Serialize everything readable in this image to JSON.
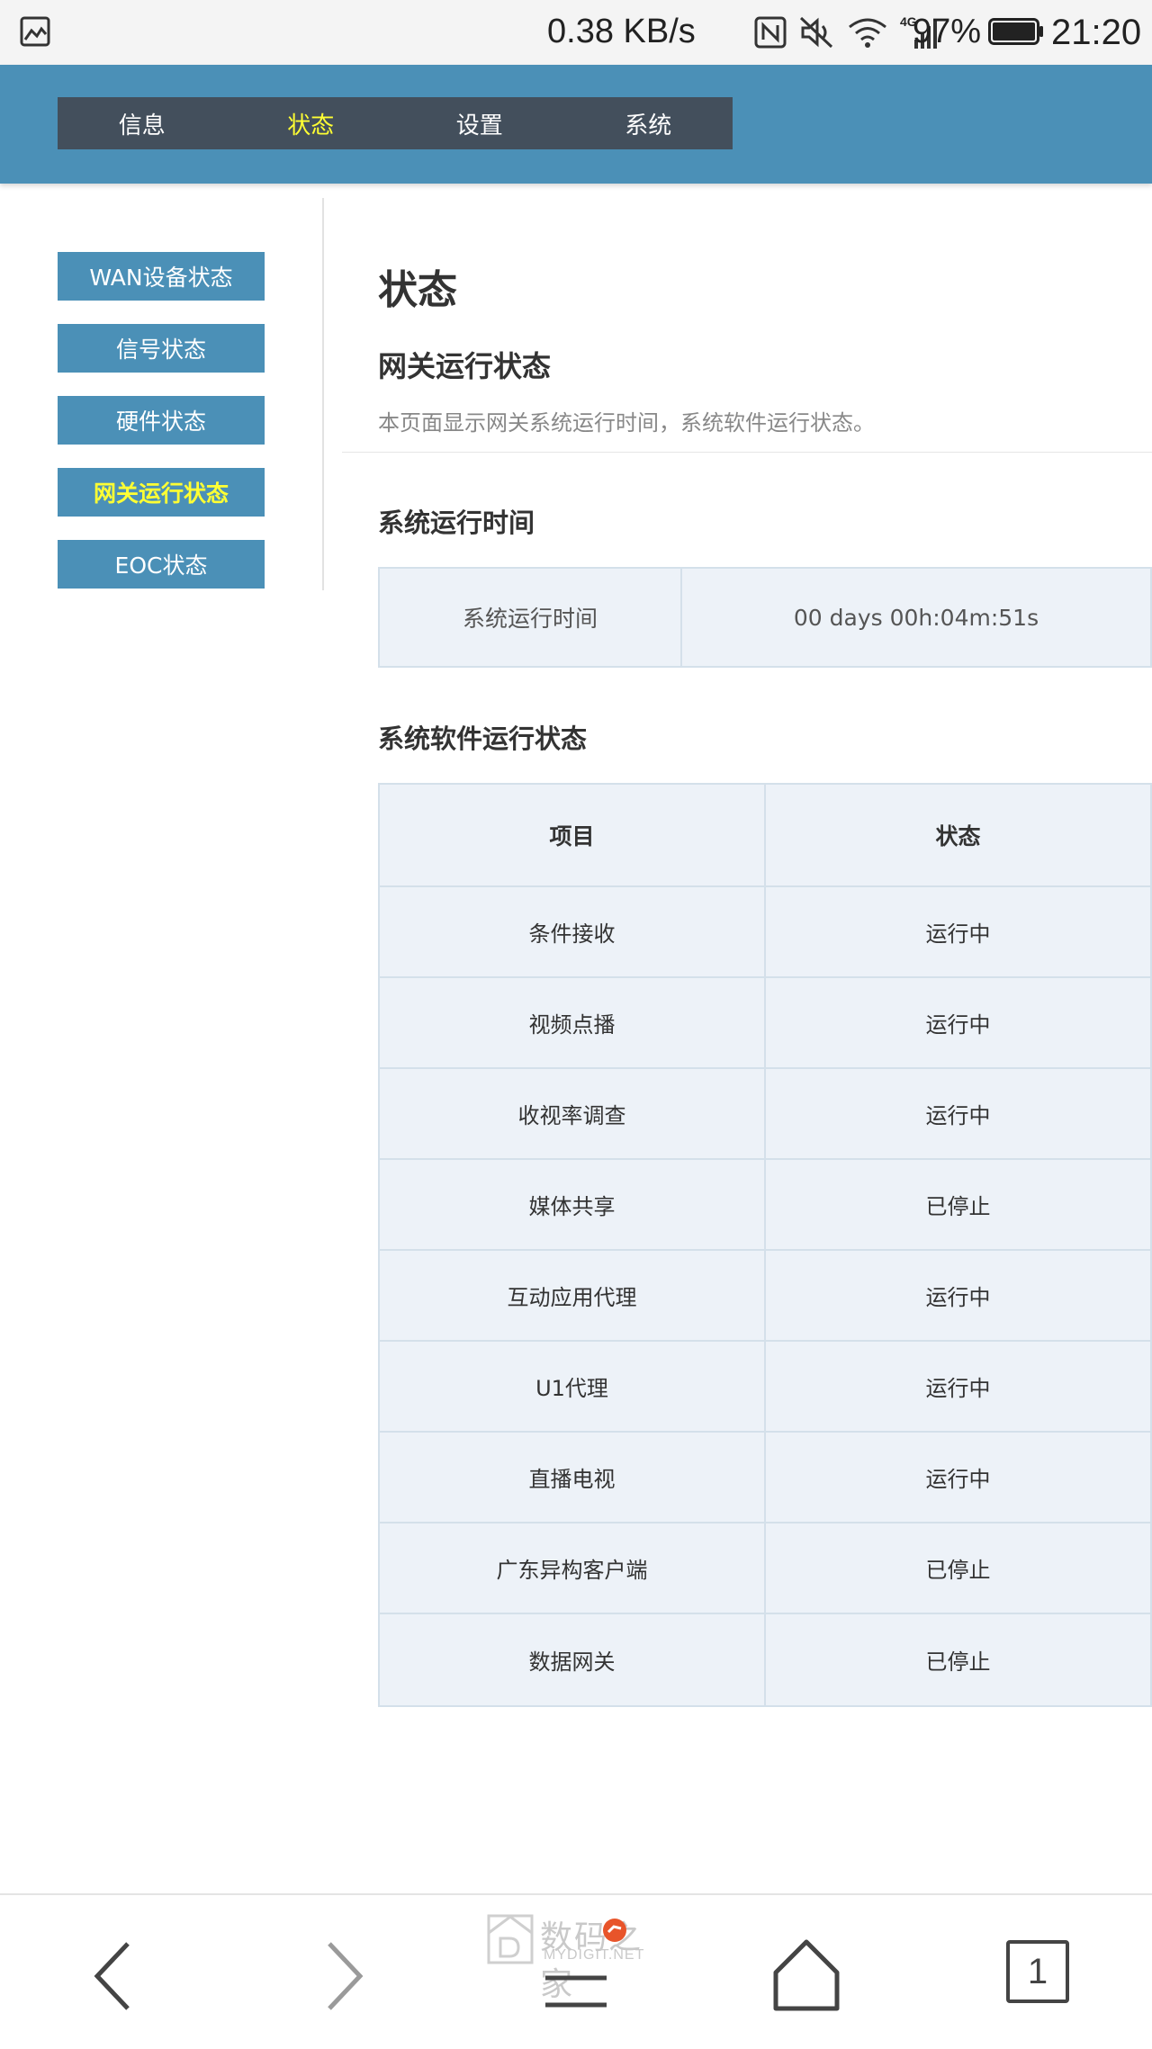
{
  "status_bar": {
    "speed": "0.38 KB/s",
    "network": "4G",
    "battery_percent": "97%",
    "time": "21:20",
    "icons": [
      "image-icon",
      "nfc-icon",
      "mute-icon",
      "wifi-icon",
      "signal-icon",
      "battery-icon"
    ]
  },
  "topnav": {
    "tabs": [
      {
        "label": "信息"
      },
      {
        "label": "状态",
        "active": true
      },
      {
        "label": "设置"
      },
      {
        "label": "系统"
      }
    ],
    "active_color": "#ffff33",
    "bg_color": "#434f5c"
  },
  "header": {
    "bg_color": "#4b90b7"
  },
  "sidebar": {
    "items": [
      {
        "label": "WAN设备状态"
      },
      {
        "label": "信号状态"
      },
      {
        "label": "硬件状态"
      },
      {
        "label": "网关运行状态",
        "active": true
      },
      {
        "label": "EOC状态"
      }
    ]
  },
  "main": {
    "title": "状态",
    "subtitle": "网关运行状态",
    "description": "本页面显示网关系统运行时间，系统软件运行状态。",
    "uptime_section": {
      "heading": "系统运行时间",
      "label": "系统运行时间",
      "value": "00 days 00h:04m:51s"
    },
    "software_section": {
      "heading": "系统软件运行状态",
      "headers": [
        "项目",
        "状态"
      ],
      "rows": [
        {
          "item": "条件接收",
          "status": "运行中"
        },
        {
          "item": "视频点播",
          "status": "运行中"
        },
        {
          "item": "收视率调查",
          "status": "运行中"
        },
        {
          "item": "媒体共享",
          "status": "已停止"
        },
        {
          "item": "互动应用代理",
          "status": "运行中"
        },
        {
          "item": "U1代理",
          "status": "运行中"
        },
        {
          "item": "直播电视",
          "status": "运行中"
        },
        {
          "item": "广东异构客户端",
          "status": "已停止"
        },
        {
          "item": "数据网关",
          "status": "已停止"
        }
      ]
    }
  },
  "bottom_bar": {
    "watermark_name": "数码之家",
    "watermark_url": "MYDIGIT.NET",
    "tabs_count": "1"
  }
}
